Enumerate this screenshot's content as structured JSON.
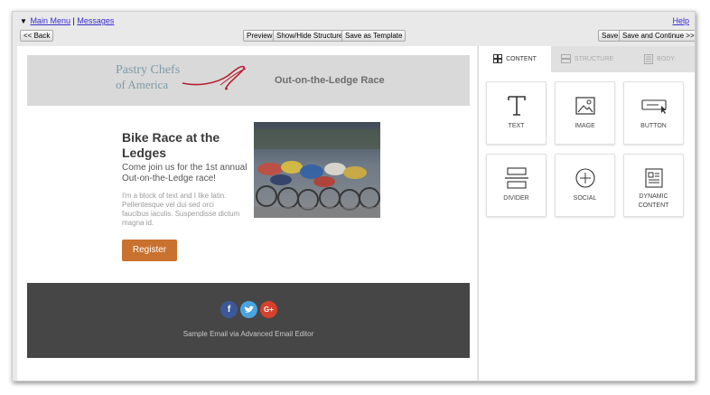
{
  "nav": {
    "triangle": "▼",
    "main_menu": "Main Menu",
    "separator": "|",
    "messages": "Messages",
    "help": "Help"
  },
  "toolbar": {
    "back": "<< Back",
    "preview": "Preview",
    "show_hide": "Show/Hide Structure",
    "save_template": "Save as Template",
    "save": "Save",
    "save_continue": "Save and Continue >>"
  },
  "email": {
    "logo_line1": "Pastry Chefs",
    "logo_line2": "of America",
    "header_title": "Out-on-the-Ledge Race",
    "headline": "Bike Race at the Ledges",
    "subheadline": "Come join us for the 1st annual Out-on-the-Ledge race!",
    "body_text": "I'm a block of text and I like latin. Pellentesque vel dui sed orci faucibus iaculis. Suspendisse dictum magna id.",
    "cta_label": "Register",
    "social": [
      {
        "name": "facebook-icon",
        "glyph": "f",
        "color": "#3b5998"
      },
      {
        "name": "twitter-icon",
        "glyph": "t",
        "color": "#4aa3df"
      },
      {
        "name": "google-plus-icon",
        "glyph": "G+",
        "color": "#d6412d"
      }
    ],
    "footer_text": "Sample Email via Advanced Email Editor"
  },
  "panel": {
    "tabs": [
      {
        "label": "CONTENT",
        "icon": "grid-icon",
        "active": true
      },
      {
        "label": "STRUCTURE",
        "icon": "rows-icon",
        "active": false
      },
      {
        "label": "BODY",
        "icon": "document-icon",
        "active": false
      }
    ],
    "tiles": [
      {
        "label": "TEXT",
        "icon": "text-icon"
      },
      {
        "label": "IMAGE",
        "icon": "image-icon"
      },
      {
        "label": "BUTTON",
        "icon": "button-icon"
      },
      {
        "label": "DIVIDER",
        "icon": "divider-icon"
      },
      {
        "label": "SOCIAL",
        "icon": "social-plus-icon"
      },
      {
        "label": "DYNAMIC CONTENT",
        "icon": "dynamic-content-icon"
      }
    ]
  }
}
